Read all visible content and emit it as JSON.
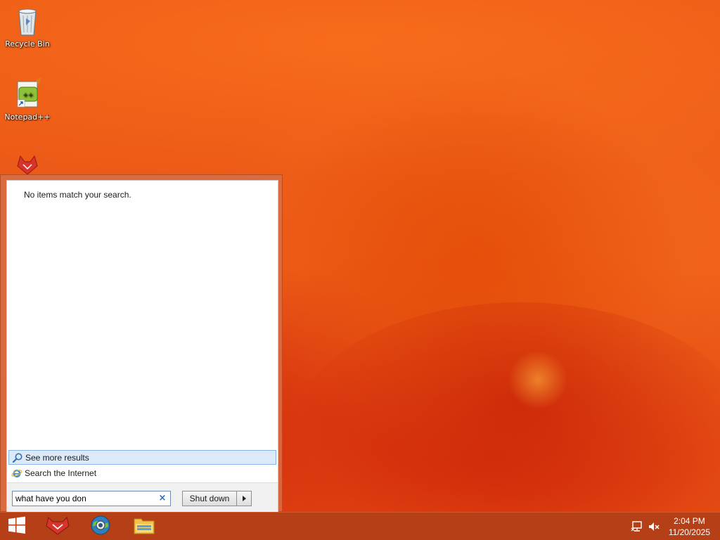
{
  "desktop": {
    "icons": [
      {
        "label": "Recycle Bin",
        "icon": "recycle-bin-icon"
      },
      {
        "label": "Notepad++",
        "icon": "notepad-plus-plus-icon"
      },
      {
        "label": "",
        "icon": "app-shortcut-icon"
      }
    ]
  },
  "start_menu": {
    "no_results_text": "No items match your search.",
    "see_more_label": "See more results",
    "search_internet_label": "Search the Internet",
    "search": {
      "value": "what have you don",
      "placeholder": ""
    },
    "shutdown_label": "Shut down"
  },
  "taskbar": {
    "items": [
      {
        "icon": "windows-start-icon"
      },
      {
        "icon": "app-icon"
      },
      {
        "icon": "browser-globe-icon"
      },
      {
        "icon": "file-explorer-icon"
      }
    ],
    "tray": {
      "network_icon": "network-icon",
      "volume_icon": "volume-muted-icon"
    },
    "clock": {
      "time": "2:04 PM",
      "date": "11/20/2025"
    }
  },
  "colors": {
    "wallpaper": "#ec5a17",
    "taskbar": "#b53f16",
    "selection": "#dbe9f9",
    "accent": "#2a6ab8"
  }
}
